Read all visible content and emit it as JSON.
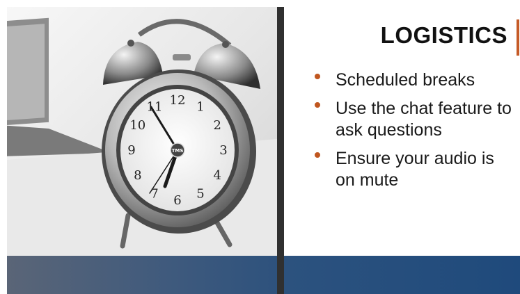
{
  "slide": {
    "title": "LOGISTICS",
    "bullets": [
      "Scheduled breaks",
      "Use the chat feature to ask questions",
      "Ensure your audio is on mute"
    ],
    "clock": {
      "numerals": [
        "12",
        "1",
        "2",
        "3",
        "4",
        "5",
        "6",
        "7",
        "8",
        "9",
        "10",
        "11"
      ],
      "center_logo": "TMS"
    },
    "colors": {
      "accent": "#c0561f",
      "divider": "#303030",
      "footer": "#1f4a7c",
      "title_text": "#111111"
    }
  }
}
